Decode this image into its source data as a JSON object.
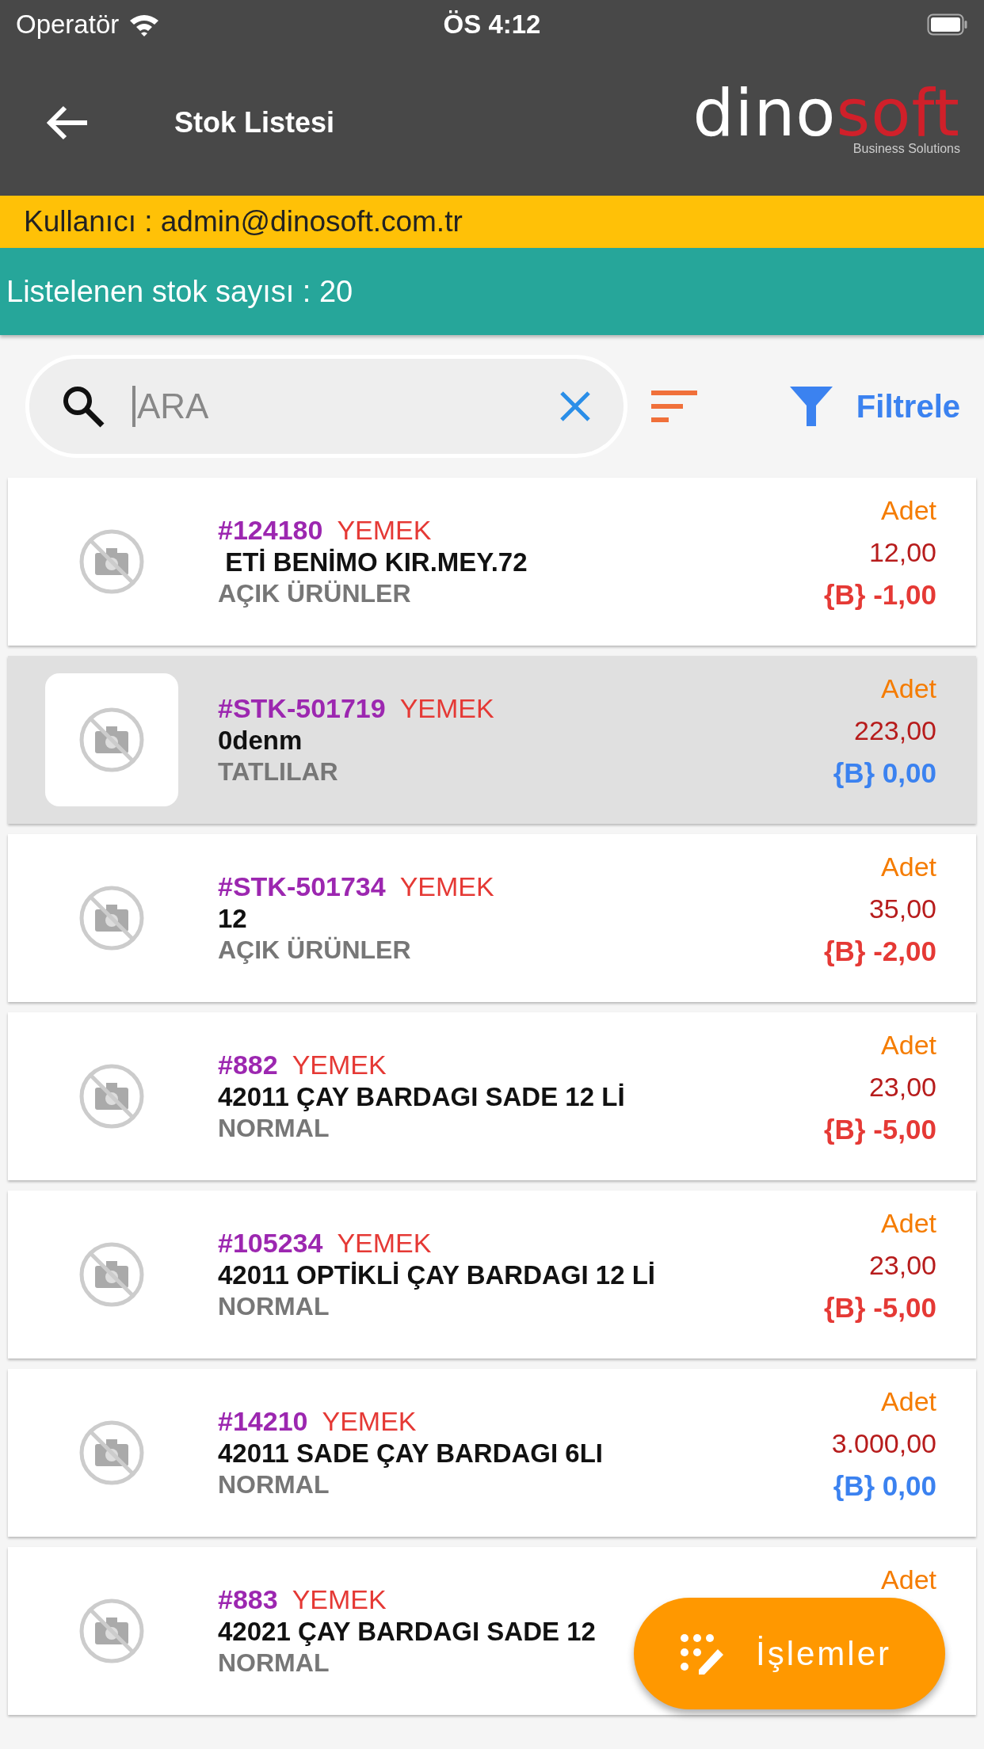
{
  "status_bar": {
    "carrier": "Operatör",
    "time": "ÖS 4:12"
  },
  "app_bar": {
    "title": "Stok Listesi",
    "logo": {
      "part_1": "dino",
      "part_2": "soft",
      "tagline": "Business Solutions"
    }
  },
  "user_banner": "Kullanıcı : admin@dinosoft.com.tr",
  "count_banner": "Listelenen stok sayısı : 20",
  "search": {
    "placeholder": "ARA",
    "filter_label": "Filtrele"
  },
  "stocks": [
    {
      "code": "#124180",
      "group": "YEMEK",
      "name": " ETİ BENİMO KIR.MEY.72",
      "category": "AÇIK ÜRÜNLER",
      "unit": "Adet",
      "quantity": "12,00",
      "balance": "{B} -1,00",
      "kind": "negative",
      "selected": false
    },
    {
      "code": "#STK-501719",
      "group": "YEMEK",
      "name": "0denm",
      "category": "TATLILAR",
      "unit": "Adet",
      "quantity": "223,00",
      "balance": "{B} 0,00",
      "kind": "zero",
      "selected": true
    },
    {
      "code": "#STK-501734",
      "group": "YEMEK",
      "name": "12",
      "category": "AÇIK ÜRÜNLER",
      "unit": "Adet",
      "quantity": "35,00",
      "balance": "{B} -2,00",
      "kind": "negative",
      "selected": false
    },
    {
      "code": "#882",
      "group": "YEMEK",
      "name": "42011 ÇAY BARDAGI SADE 12 Lİ",
      "category": "NORMAL",
      "unit": "Adet",
      "quantity": "23,00",
      "balance": "{B} -5,00",
      "kind": "negative",
      "selected": false
    },
    {
      "code": "#105234",
      "group": "YEMEK",
      "name": "42011 OPTİKLİ ÇAY BARDAGI 12 Lİ",
      "category": "NORMAL",
      "unit": "Adet",
      "quantity": "23,00",
      "balance": "{B} -5,00",
      "kind": "negative",
      "selected": false
    },
    {
      "code": "#14210",
      "group": "YEMEK",
      "name": "42011 SADE ÇAY BARDAGI 6LI",
      "category": "NORMAL",
      "unit": "Adet",
      "quantity": "3.000,00",
      "balance": "{B} 0,00",
      "kind": "zero",
      "selected": false
    },
    {
      "code": "#883",
      "group": "YEMEK",
      "name": "42021 ÇAY BARDAGI SADE 12",
      "category": "NORMAL",
      "unit": "Adet",
      "selected": false
    }
  ],
  "actions_button": {
    "label": "İşlemler"
  }
}
